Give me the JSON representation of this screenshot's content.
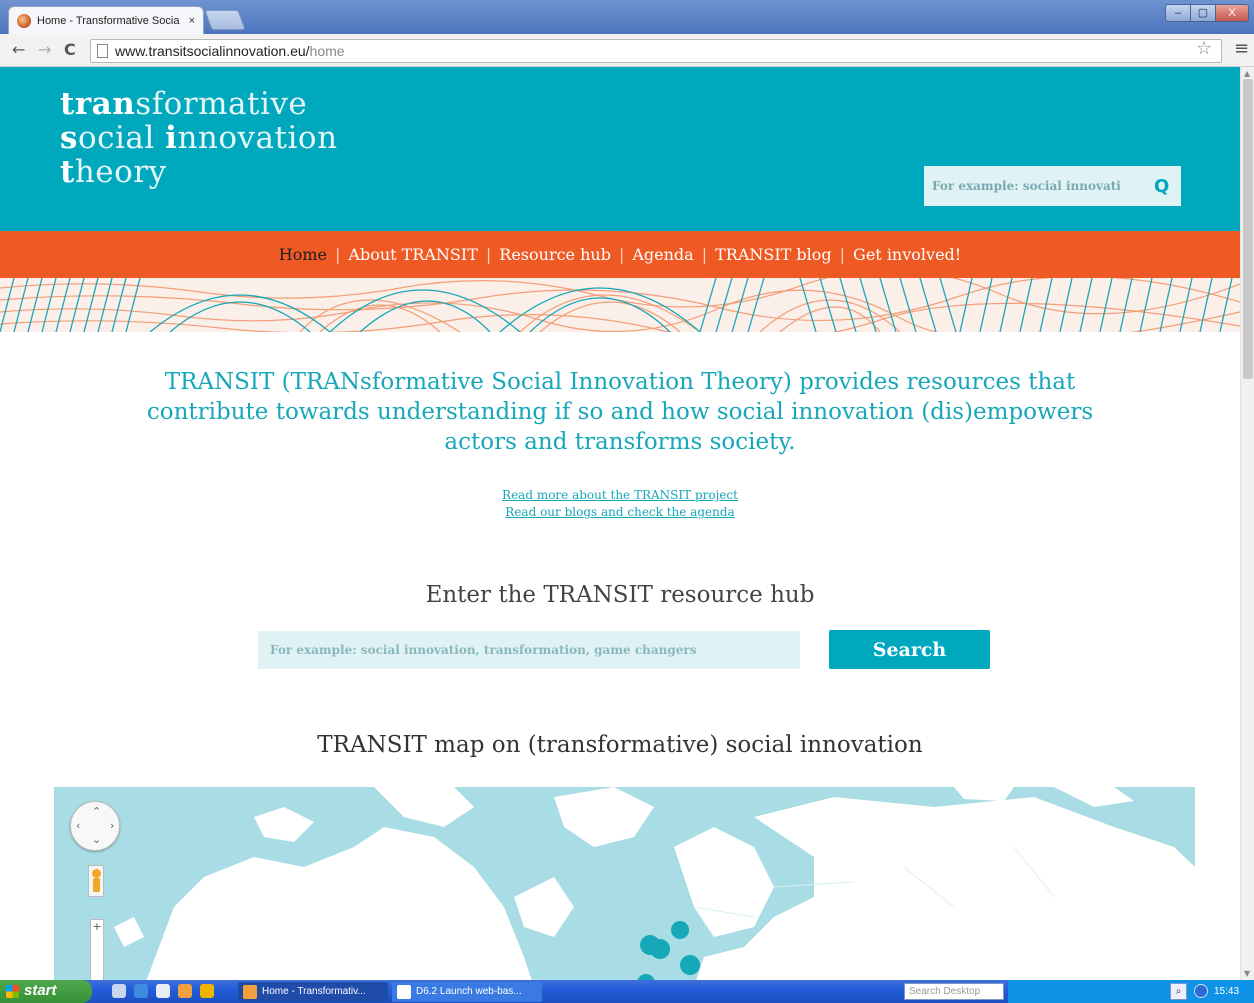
{
  "browser": {
    "tab_title": "Home - Transformative Socia",
    "tab_close": "×",
    "url_host": "www.transitsocialinnovation.eu/",
    "url_path": "home",
    "back": "←",
    "forward": "→",
    "reload": "C",
    "star": "☆",
    "menu": "≡",
    "win_min": "–",
    "win_max": "▢",
    "win_close": "X"
  },
  "header": {
    "logo_line1_bold": "tran",
    "logo_line1_rest": "sformative",
    "logo_line2_bold1": "s",
    "logo_line2_rest1": "ocial ",
    "logo_line2_bold2": "i",
    "logo_line2_rest2": "nnovation",
    "logo_line3_bold": "t",
    "logo_line3_rest": "heory",
    "search_placeholder": "For example: social innovati",
    "search_icon": "Q"
  },
  "nav": {
    "items": [
      "Home",
      "About TRANSIT",
      "Resource hub",
      "Agenda",
      "TRANSIT blog",
      "Get involved!"
    ],
    "separator": "|"
  },
  "main": {
    "intro": "TRANSIT (TRANsformative Social Innovation Theory) provides resources that contribute towards understanding if so and how social innovation (dis)empowers actors and transforms society.",
    "link_project": "Read more about the TRANSIT project",
    "link_blogs": "Read our blogs and check the agenda",
    "hub_title": "Enter the TRANSIT resource hub",
    "hub_placeholder": "For example: social innovation, transformation, game changers",
    "hub_button": "Search",
    "map_title": "TRANSIT map on (transformative) social innovation",
    "map_zoom_in": "+"
  },
  "colors": {
    "teal": "#00a8bd",
    "orange": "#ef5a24",
    "map_water": "#a9dde5",
    "map_land": "#ffffff",
    "marker": "#16a7b9"
  },
  "taskbar": {
    "start": "start",
    "task1": "Home - Transformativ...",
    "task2": "D6.2 Launch web-bas...",
    "desk_search": "Search Desktop",
    "clock": "15:43"
  }
}
